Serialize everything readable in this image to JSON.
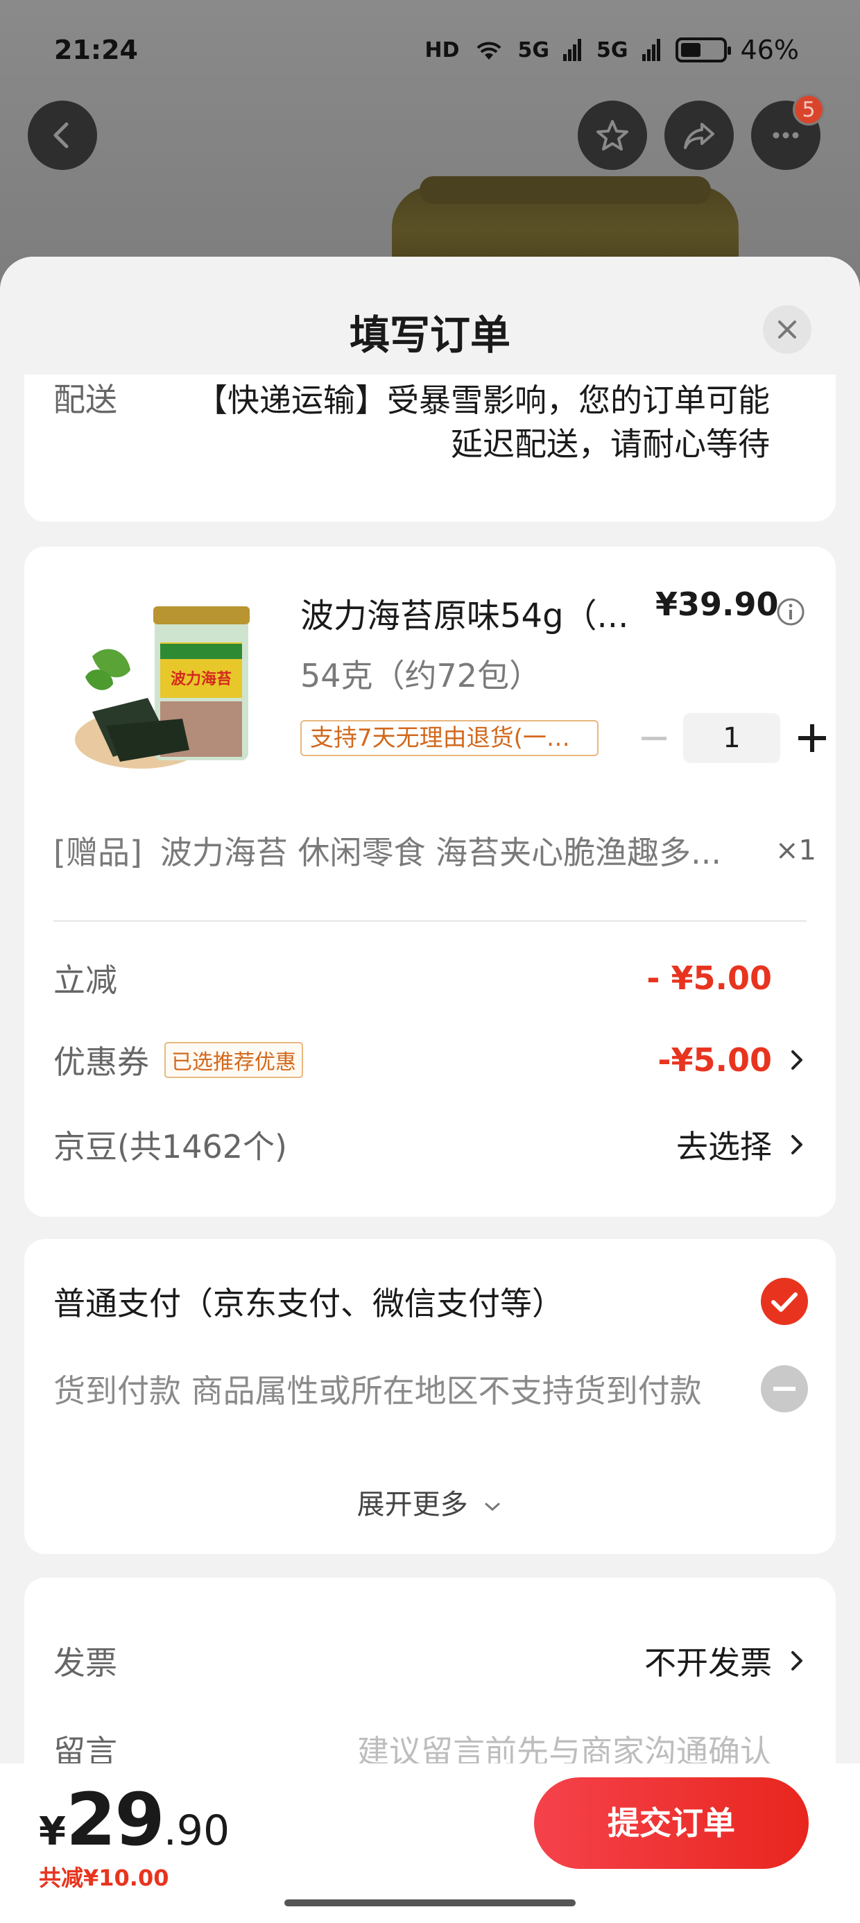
{
  "status_bar": {
    "time": "21:24",
    "hd": "HD",
    "net1": "5G",
    "net2": "5G",
    "battery": "46%"
  },
  "topbar": {
    "badge_count": "5"
  },
  "sheet": {
    "title": "填写订单"
  },
  "shipping": {
    "label": "配送",
    "notice_line1": "【快递运输】受暴雪影响，您的订单可能",
    "notice_line2": "延迟配送，请耐心等待"
  },
  "product": {
    "title": "波力海苔原味54g（...",
    "price": "¥39.90",
    "spec": "54克（约72包）",
    "return_tag": "支持7天无理由退货(一次...",
    "quantity": "1",
    "gift_label": "[赠品]",
    "gift_text": "波力海苔 休闲零食 海苔夹心脆渔趣多...",
    "gift_count": "×1",
    "package_text": "波力海苔"
  },
  "discounts": {
    "instant_label": "立减",
    "instant_value": "- ¥5.00",
    "coupon_label": "优惠券",
    "coupon_tag": "已选推荐优惠",
    "coupon_value": "-¥5.00",
    "jingdou_label": "京豆(共1462个)",
    "jingdou_action": "去选择"
  },
  "payment": {
    "normal": "普通支付（京东支付、微信支付等）",
    "cod": "货到付款 商品属性或所在地区不支持货到付款",
    "expand": "展开更多"
  },
  "misc": {
    "invoice_label": "发票",
    "invoice_value": "不开发票",
    "note_label": "留言",
    "note_placeholder": "建议留言前先与商家沟通确认"
  },
  "bottom": {
    "yen": "¥",
    "total_int": "29",
    "total_dec": ".90",
    "saving": "共减¥10.00",
    "submit": "提交订单"
  },
  "colors": {
    "accent_red": "#e8341f",
    "button_red": "#f5424b",
    "tag_orange": "#d2691e"
  }
}
